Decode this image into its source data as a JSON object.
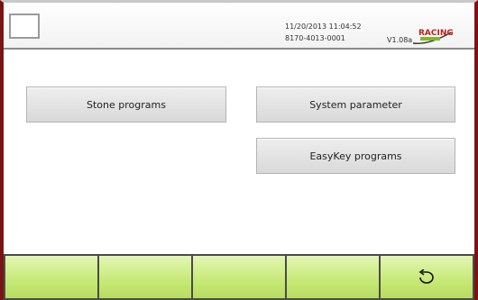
{
  "header": {
    "datetime": "11/20/2013 11:04:52",
    "serial": "8170-4013-0001",
    "version": "V1.08a",
    "logo_icon": "racing-logo-icon"
  },
  "menu": {
    "stone_programs": "Stone programs",
    "system_parameter": "System parameter",
    "easykey_programs": "EasyKey programs"
  },
  "footer": {
    "buttons": [
      "",
      "",
      "",
      "",
      ""
    ],
    "back_icon": "back-arrow-icon"
  },
  "colors": {
    "frame": "#7a1414",
    "footer_green": "#c9ea7a",
    "button_gray": "#e0e0e0"
  }
}
